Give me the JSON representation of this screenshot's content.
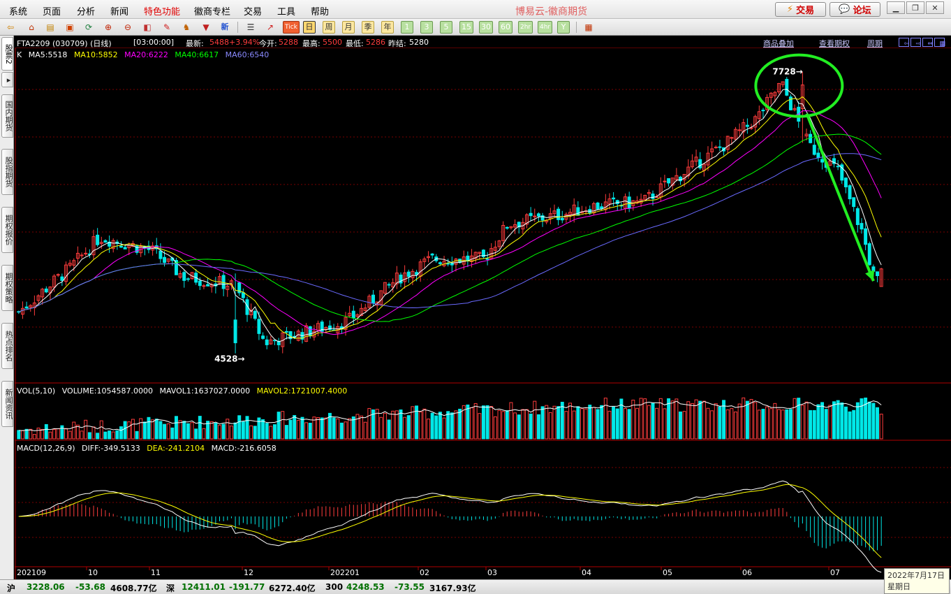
{
  "menu": {
    "items": [
      "系统",
      "页面",
      "分析",
      "新闻",
      "特色功能",
      "徽商专栏",
      "交易",
      "工具",
      "帮助"
    ],
    "special_index": 4
  },
  "app_title": "博易云-徽商期货",
  "top_buttons": {
    "trade": "交易",
    "forum": "论坛"
  },
  "toolbar": {
    "periods": [
      "日",
      "周",
      "月",
      "季",
      "年",
      "1",
      "3",
      "5",
      "15",
      "30",
      "60",
      "2hr",
      "4hr",
      "Y"
    ],
    "active_period": "日",
    "tick_label": "Tick",
    "new_label": "新"
  },
  "sidebar": {
    "tabs": [
      "股票2",
      "国内期货",
      "股指期货",
      "期权报价",
      "期权策略",
      "热点排名",
      "新闻资讯"
    ]
  },
  "quote": {
    "symbol": "FTA2209 (030709) (日线)",
    "time": "[03:00:00]",
    "latest_label": "最新:",
    "latest": "5488",
    "change_pct": "+3.94%",
    "open_label": "今开:",
    "open": "5288",
    "high_label": "最高:",
    "high": "5500",
    "low_label": "最低:",
    "low": "5286",
    "prev_close_label": "昨结:",
    "prev_close": "5280"
  },
  "links": {
    "overlay": "商品叠加",
    "options": "查看期权",
    "period": "周期"
  },
  "legends": {
    "k": "K",
    "ma5": "MA5:5518",
    "ma10": "MA10:5852",
    "ma20": "MA20:6222",
    "ma40": "MA40:6617",
    "ma60": "MA60:6540",
    "vol_title": "VOL(5,10)",
    "volume": "VOLUME:1054587.0000",
    "mavol1": "MAVOL1:1637027.0000",
    "mavol2": "MAVOL2:1721007.4000",
    "macd_title": "MACD(12,26,9)",
    "diff": "DIFF:-349.5133",
    "dea": "DEA:-241.2104",
    "macd": "MACD:-216.6058"
  },
  "annotations": {
    "high_label": "7728→",
    "low_label": "4528→"
  },
  "colors": {
    "up": "#ff3c3c",
    "down": "#00e8e8",
    "ma5": "#ffffff",
    "ma10": "#ffff00",
    "ma20": "#ff00ff",
    "ma40": "#00ff00",
    "ma60": "#6a6aff",
    "grid": "#7a0000",
    "highlight": "#22ee22"
  },
  "chart_data": {
    "type": "candlestick",
    "symbol": "FTA2209",
    "x_tick_labels": [
      "202109",
      "10",
      "11",
      "12",
      "202201",
      "02",
      "03",
      "04",
      "05",
      "06",
      "07"
    ],
    "price_range": [
      4200,
      7900
    ],
    "marked_high": 7728,
    "marked_low": 4528,
    "last_bar": {
      "open": 5288,
      "high": 5500,
      "low": 5286,
      "close": 5488,
      "prev_settle": 5280
    },
    "price_path_approx": [
      {
        "date": "2021-09-01",
        "close": 5000
      },
      {
        "date": "2021-09-20",
        "close": 5500
      },
      {
        "date": "2021-10-01",
        "close": 5850
      },
      {
        "date": "2021-10-20",
        "close": 5700
      },
      {
        "date": "2021-11-01",
        "close": 5400
      },
      {
        "date": "2021-11-20",
        "close": 5300
      },
      {
        "date": "2021-12-01",
        "close": 4650
      },
      {
        "date": "2021-12-20",
        "close": 4800
      },
      {
        "date": "2022-01-01",
        "close": 4900
      },
      {
        "date": "2022-01-20",
        "close": 5400
      },
      {
        "date": "2022-02-01",
        "close": 5600
      },
      {
        "date": "2022-02-20",
        "close": 5600
      },
      {
        "date": "2022-03-01",
        "close": 6000
      },
      {
        "date": "2022-03-20",
        "close": 6100
      },
      {
        "date": "2022-04-01",
        "close": 6200
      },
      {
        "date": "2022-04-20",
        "close": 6250
      },
      {
        "date": "2022-05-01",
        "close": 6500
      },
      {
        "date": "2022-05-20",
        "close": 6900
      },
      {
        "date": "2022-06-01",
        "close": 7200
      },
      {
        "date": "2022-06-10",
        "close": 7600
      },
      {
        "date": "2022-06-20",
        "close": 6900
      },
      {
        "date": "2022-07-01",
        "close": 6600
      },
      {
        "date": "2022-07-10",
        "close": 5900
      },
      {
        "date": "2022-07-15",
        "close": 5300
      },
      {
        "date": "2022-07-17",
        "close": 5488
      }
    ]
  },
  "statusbar": {
    "sh_label": "沪",
    "sh_value": "3228.06",
    "sh_change": "-53.68",
    "sh_amount": "4608.77亿",
    "sz_label": "深",
    "sz_value": "12411.01",
    "sz_change": "-191.77",
    "sz_amount": "6272.40亿",
    "i300_label": "300",
    "i300_value": "4248.53",
    "i300_change": "-73.55",
    "i300_amount": "3167.93亿"
  },
  "date_tip": {
    "date": "2022年7月17日",
    "weekday": "星期日"
  }
}
